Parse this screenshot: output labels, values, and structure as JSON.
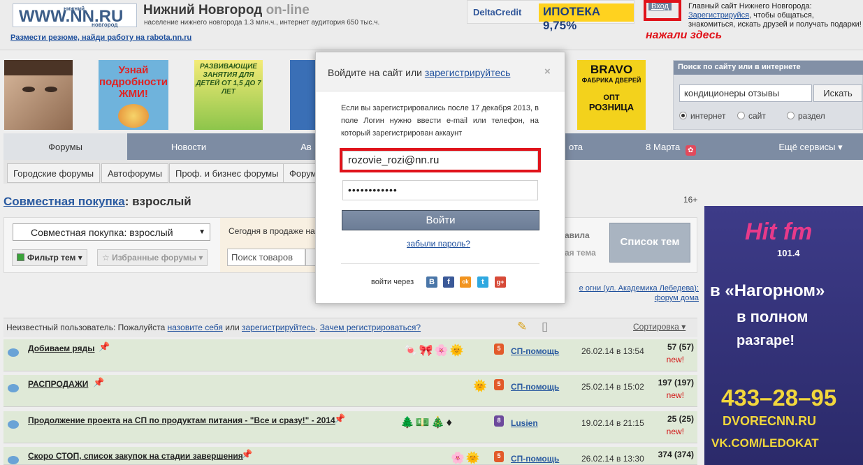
{
  "header": {
    "logo_text": "WWW.NN.RU",
    "logo_small_top": "нижний",
    "logo_small_bottom": "новгород",
    "site_title": "Нижний Новгород",
    "site_title_suffix": "on-line",
    "site_subtitle": "население нижнего новгорода 1.3 млн.ч., интернет аудитория 650 тыс.ч.",
    "rabota_link": "Размести резюме, найди работу на rabota.nn.ru",
    "ad_delta": "DeltaCredit",
    "ad_ipoteka": "ИПОТЕКА 9,75%",
    "login_link": "Вход",
    "red_note": "нажали здесь",
    "info_prefix": "Главный сайт Нижнего Новгорода:",
    "info_register": "Зарегистрируйся",
    "info_suffix": ", чтобы общаться, знакомиться, искать друзей и получать подарки!"
  },
  "banners": {
    "learn_text1": "Узнай",
    "learn_text2": "подробности",
    "learn_text3": "ЖМИ!",
    "kids_text": "РАЗВИВАЮЩИЕ ЗАНЯТИЯ ДЛЯ ДЕТЕЙ ОТ 1,5 ДО 7 ЛЕТ",
    "bravo_title": "BRAVO",
    "bravo_sub": "ФАБРИКА ДВЕРЕЙ",
    "bravo_opt": "ОПТ",
    "bravo_retail": "РОЗНИЦА"
  },
  "search": {
    "title": "Поиск по сайту или в интернете",
    "value": "кондиционеры отзывы",
    "button": "Искать",
    "options": [
      "интернет",
      "сайт",
      "раздел"
    ],
    "selected": "интернет"
  },
  "nav": {
    "items": [
      "Форумы",
      "Новости",
      "Ав",
      "ота",
      "8 Марта",
      "Ещё сервисы ▾"
    ],
    "active": "Форумы"
  },
  "subnav": {
    "items": [
      "Городские форумы",
      "Автофорумы",
      "Проф. и бизнес форумы",
      "Форум"
    ]
  },
  "content": {
    "crumb_link": "Совместная покупка",
    "crumb_rest": ": взрослый",
    "age": "16+",
    "forum_select": "Совместная покупка: взрослый",
    "filter_btn": "Фильтр тем",
    "fav_btn": "Избранные форумы",
    "sale_text": "Сегодня в продаже на",
    "goods_placeholder": "Поиск товаров",
    "rules": "авила",
    "new_topic": "ая тема",
    "list_btn": "Список тем",
    "ad_link": "е огни (ул. Академика Лебедева): форум дома",
    "user_prefix": "Неизвестный пользователь: Пожалуйста",
    "user_link1": "назовите себя",
    "user_or": " или ",
    "user_link2": "зарегистрируйтесь",
    "user_link3": "Зачем регистрироваться?",
    "sort": "Сортировка ▾"
  },
  "topics": [
    {
      "title": "Добиваем ряды",
      "author": "СП-помощь",
      "date": "26.02.14 в 13:54",
      "count": "57 (57)",
      "new": "new!"
    },
    {
      "title": "РАСПРОДАЖИ",
      "author": "СП-помощь",
      "date": "25.02.14 в 15:02",
      "count": "197 (197)",
      "new": "new!"
    },
    {
      "title": "Продолжение проекта на СП по продуктам питания - \"Все и сразу!\" - 2014",
      "author": "Lusien",
      "date": "19.02.14 в 21:15",
      "count": "25 (25)",
      "new": "new!"
    },
    {
      "title": "Скоро СТОП, список закупок на стадии завершения",
      "author": "СП-помощь",
      "date": "26.02.14 в 13:30",
      "count": "374 (374)",
      "new": ""
    }
  ],
  "right_ad": {
    "logo": "Hit fm",
    "freq": "101.4",
    "line1": "в «Нагорном»",
    "line2": "в полном",
    "line3": "разгаре!",
    "phone": "433–28–95",
    "site": "DVORECNN.RU",
    "vk": "VK.COM/LEDOKAT"
  },
  "modal": {
    "title_prefix": "Войдите на сайт или ",
    "title_link": "зарегистрируйтесь",
    "close": "×",
    "note": "Если вы зарегистрировались после 17 декабря 2013, в поле Логин нужно ввести e-mail или телефон, на который зарегистрирован аккаунт",
    "login_value": "rozovie_rozi@nn.ru",
    "password_value": "••••••••••••",
    "submit": "Войти",
    "forgot": "забыли пароль?",
    "via": "войти через",
    "socials": [
      "В",
      "f",
      "ok",
      "t",
      "g+"
    ]
  },
  "colors": {
    "nav": "#7d8ca3",
    "link": "#1e4f9c",
    "highlight": "#e0131b",
    "row_bg": "#dfe9d7"
  }
}
